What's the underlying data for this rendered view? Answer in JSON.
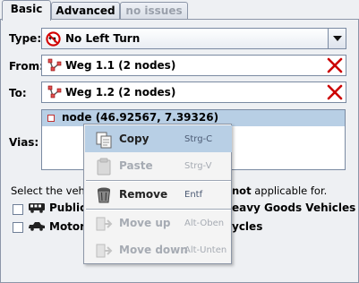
{
  "tabs": [
    {
      "label": "Basic"
    },
    {
      "label": "Advanced"
    },
    {
      "label": "no issues"
    }
  ],
  "type": {
    "label": "Type:",
    "value": "No Left Turn",
    "icon": "no-left-turn-icon"
  },
  "from": {
    "label": "From:",
    "value": "Weg 1.1 (2 nodes)",
    "icon": "way-icon"
  },
  "to": {
    "label": "To:",
    "value": "Weg 1.2 (2 nodes)",
    "icon": "way-icon"
  },
  "vias": {
    "label": "Vias:",
    "items": [
      {
        "text": "node (46.92567, 7.39326)",
        "icon": "node-icon"
      }
    ]
  },
  "vehicles": {
    "prompt_start": "Select the vehi",
    "prompt_end_bold": "not",
    "prompt_end": " applicable for.",
    "options": [
      {
        "left": "Public",
        "right": "eavy Goods Vehicles",
        "icon": "bus-icon",
        "checked": false
      },
      {
        "left": "Motoro",
        "right": "ycles",
        "icon": "car-icon",
        "checked": false
      }
    ]
  },
  "context_menu": {
    "items": [
      {
        "label": "Copy",
        "shortcut": "Strg-C",
        "icon": "copy-icon",
        "enabled": true,
        "selected": true
      },
      {
        "label": "Paste",
        "shortcut": "Strg-V",
        "icon": "paste-icon",
        "enabled": false
      },
      {
        "label": "Remove",
        "shortcut": "Entf",
        "icon": "remove-icon",
        "enabled": true
      },
      {
        "label": "Move up",
        "shortcut": "Alt-Oben",
        "icon": "move-up-icon",
        "enabled": false
      },
      {
        "label": "Move down",
        "shortcut": "Alt-Unten",
        "icon": "move-down-icon",
        "enabled": false
      }
    ]
  },
  "colors": {
    "selection": "#b8cfe5",
    "delete_x": "#cc0000",
    "prohibit_red": "#d40000"
  }
}
